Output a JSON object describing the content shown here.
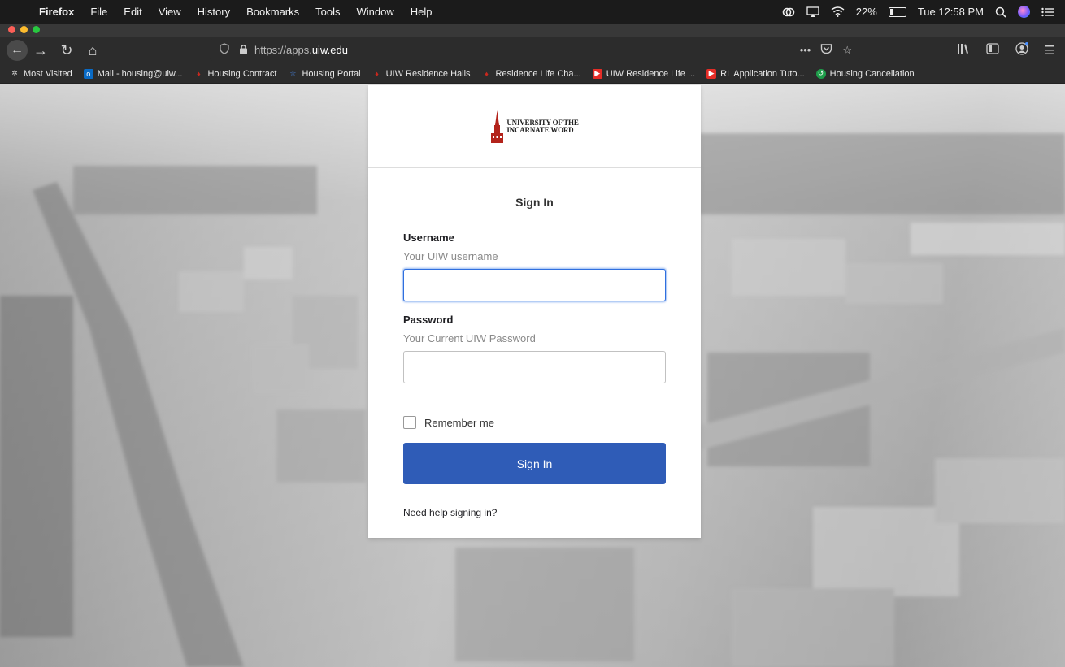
{
  "menubar": {
    "app": "Firefox",
    "items": [
      "File",
      "Edit",
      "View",
      "History",
      "Bookmarks",
      "Tools",
      "Window",
      "Help"
    ],
    "battery": "22%",
    "clock": "Tue 12:58 PM"
  },
  "browser": {
    "url_prefix": "https://apps.",
    "url_host": "uiw.edu",
    "bookmarks": [
      {
        "label": "Most Visited",
        "icon": "gear-icon",
        "color": "#cccccc"
      },
      {
        "label": "Mail - housing@uiw...",
        "icon": "outlook-icon",
        "color": "#0a6bc6"
      },
      {
        "label": "Housing Contract",
        "icon": "uiw-flame-icon",
        "color": "#c8281e"
      },
      {
        "label": "Housing Portal",
        "icon": "star-icon",
        "color": "#4a8cf0"
      },
      {
        "label": "UIW Residence Halls",
        "icon": "uiw-flame-icon",
        "color": "#c8281e"
      },
      {
        "label": "Residence Life Cha...",
        "icon": "uiw-flame-icon",
        "color": "#c8281e"
      },
      {
        "label": "UIW Residence Life ...",
        "icon": "youtube-icon",
        "color": "#e52d27"
      },
      {
        "label": "RL Application Tuto...",
        "icon": "youtube-icon",
        "color": "#e52d27"
      },
      {
        "label": "Housing Cancellation",
        "icon": "cancel-app-icon",
        "color": "#1e9e4a"
      }
    ]
  },
  "login": {
    "logo_line1": "UNIVERSITY OF THE",
    "logo_line2": "INCARNATE WORD",
    "title": "Sign In",
    "username_label": "Username",
    "username_hint": "Your UIW username",
    "username_value": "",
    "password_label": "Password",
    "password_hint": "Your Current UIW Password",
    "password_value": "",
    "remember_label": "Remember me",
    "button_label": "Sign In",
    "help_link": "Need help signing in?"
  },
  "colors": {
    "primary_button": "#2f5cb7",
    "focus_ring": "#2f6fdf",
    "brand_red": "#c8281e"
  }
}
